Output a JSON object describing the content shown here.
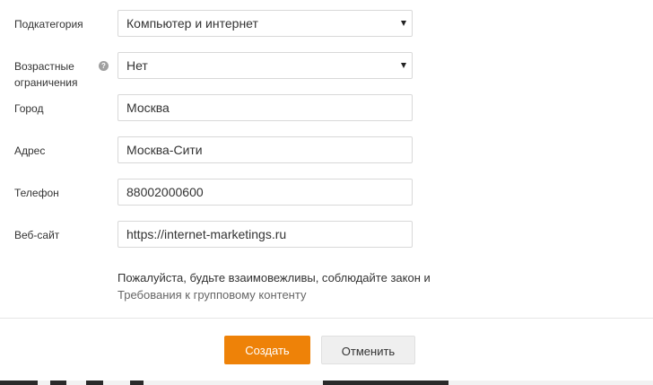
{
  "form": {
    "fields": [
      {
        "label": "Подкатегория",
        "value": "Компьютер и интернет",
        "type": "select"
      },
      {
        "label": "Возрастные ограничения",
        "value": "Нет",
        "type": "select"
      },
      {
        "label": "Город",
        "value": "Москва",
        "type": "text"
      },
      {
        "label": "Адрес",
        "value": "Москва-Сити",
        "type": "text"
      },
      {
        "label": "Телефон",
        "value": "88002000600",
        "type": "text"
      },
      {
        "label": "Веб-сайт",
        "value": "https://internet-marketings.ru",
        "type": "text"
      }
    ],
    "help_icon_glyph": "?",
    "note_text": "Пожалуйста, будьте взаимовежливы, соблюдайте закон и",
    "note_link": "Требования к групповому контенту"
  },
  "buttons": {
    "create": "Создать",
    "cancel": "Отменить"
  },
  "colors": {
    "accent": "#ee8208",
    "secondary_button": "#efefef",
    "field_border": "#d8d8d8"
  },
  "icons": {
    "help": "help-icon",
    "dropdown": "chevron-down-icon"
  }
}
